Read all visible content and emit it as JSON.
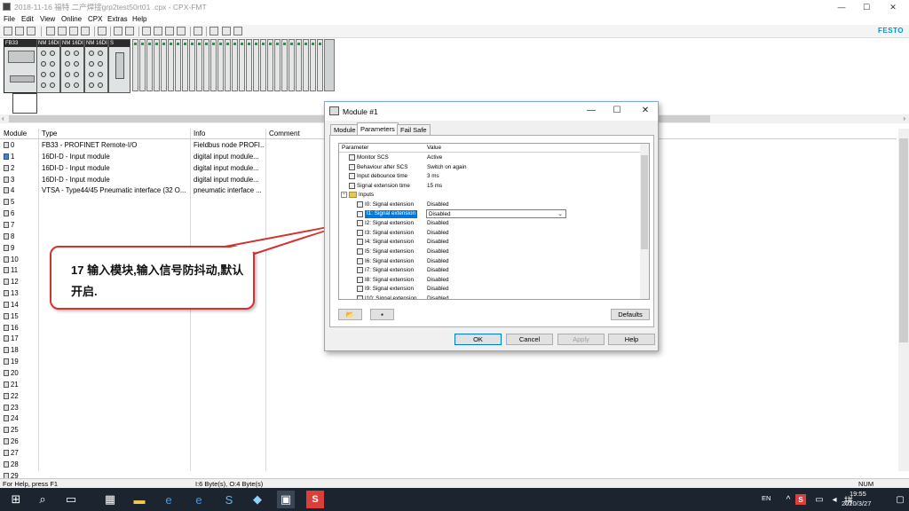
{
  "window": {
    "title": "2018-11-16 福特 二产焊接grp2test50rt01 .cpx - CPX-FMT",
    "controls": {
      "minimize": "—",
      "maximize": "☐",
      "close": "✕"
    }
  },
  "menu": [
    "File",
    "Edit",
    "View",
    "Online",
    "CPX",
    "Extras",
    "Help"
  ],
  "brand": {
    "logo": "FESTO",
    "color": "#0091dc"
  },
  "hardware": {
    "modules": [
      {
        "label": "FB33"
      },
      {
        "label": "NM 16DI-D"
      },
      {
        "label": "NM 16DI-D"
      },
      {
        "label": "NM 16DI-D"
      },
      {
        "label": "S"
      }
    ]
  },
  "grid": {
    "headers": {
      "module": "Module",
      "type": "Type",
      "info": "Info",
      "comment": "Comment"
    },
    "rows": [
      {
        "module": "0",
        "type": "FB33 - PROFINET Remote-I/O",
        "info": "Fieldbus node PROFI..."
      },
      {
        "module": "1",
        "type": "16DI-D - Input module",
        "info": "digital input module..."
      },
      {
        "module": "2",
        "type": "16DI-D - Input module",
        "info": "digital input module..."
      },
      {
        "module": "3",
        "type": "16DI-D - Input module",
        "info": "digital input module..."
      },
      {
        "module": "4",
        "type": "VTSA - Type44/45 Pneumatic interface (32 O...",
        "info": "pneumatic interface ..."
      },
      {
        "module": "5",
        "type": "",
        "info": ""
      },
      {
        "module": "6",
        "type": "",
        "info": ""
      },
      {
        "module": "7",
        "type": "",
        "info": ""
      },
      {
        "module": "8",
        "type": "",
        "info": ""
      },
      {
        "module": "9",
        "type": "",
        "info": ""
      },
      {
        "module": "10",
        "type": "",
        "info": ""
      },
      {
        "module": "11",
        "type": "",
        "info": ""
      },
      {
        "module": "12",
        "type": "",
        "info": ""
      },
      {
        "module": "13",
        "type": "",
        "info": ""
      },
      {
        "module": "14",
        "type": "",
        "info": ""
      },
      {
        "module": "15",
        "type": "",
        "info": ""
      },
      {
        "module": "16",
        "type": "",
        "info": ""
      },
      {
        "module": "17",
        "type": "",
        "info": ""
      },
      {
        "module": "18",
        "type": "",
        "info": ""
      },
      {
        "module": "19",
        "type": "",
        "info": ""
      },
      {
        "module": "20",
        "type": "",
        "info": ""
      },
      {
        "module": "21",
        "type": "",
        "info": ""
      },
      {
        "module": "22",
        "type": "",
        "info": ""
      },
      {
        "module": "23",
        "type": "",
        "info": ""
      },
      {
        "module": "24",
        "type": "",
        "info": ""
      },
      {
        "module": "25",
        "type": "",
        "info": ""
      },
      {
        "module": "26",
        "type": "",
        "info": ""
      },
      {
        "module": "27",
        "type": "",
        "info": ""
      },
      {
        "module": "28",
        "type": "",
        "info": ""
      },
      {
        "module": "29",
        "type": "",
        "info": ""
      }
    ],
    "selected_index": 1
  },
  "statusbar": {
    "help": "For Help, press F1",
    "io": "I:6 Byte(s), O:4 Byte(s)",
    "num": "NUM"
  },
  "callout": {
    "text": "17 输入模块,输入信号防抖动,默认开启.",
    "border_color": "#d3322f"
  },
  "dialog": {
    "title": "Module #1",
    "tabs": [
      "Module",
      "Parameters",
      "Fail Safe"
    ],
    "active_tab": 1,
    "param_headers": {
      "parameter": "Parameter",
      "value": "Value"
    },
    "params": [
      {
        "name": "Monitor SCS",
        "value": "Active"
      },
      {
        "name": "Behaviour after SCS",
        "value": "Switch on again"
      },
      {
        "name": "Input debounce time",
        "value": "3 ms"
      },
      {
        "name": "Signal extension time",
        "value": "15 ms"
      }
    ],
    "inputs_group": "Inputs",
    "inputs": [
      {
        "name": "I0: Signal extension",
        "value": "Disabled"
      },
      {
        "name": "I1: Signal extension",
        "value": "Disabled"
      },
      {
        "name": "I2: Signal extension",
        "value": "Disabled"
      },
      {
        "name": "I3: Signal extension",
        "value": "Disabled"
      },
      {
        "name": "I4: Signal extension",
        "value": "Disabled"
      },
      {
        "name": "I5: Signal extension",
        "value": "Disabled"
      },
      {
        "name": "I6: Signal extension",
        "value": "Disabled"
      },
      {
        "name": "I7: Signal extension",
        "value": "Disabled"
      },
      {
        "name": "I8: Signal extension",
        "value": "Disabled"
      },
      {
        "name": "I9: Signal extension",
        "value": "Disabled"
      },
      {
        "name": "I10: Signal extension",
        "value": "Disabled"
      }
    ],
    "selected_input": 1,
    "buttons": {
      "defaults": "Defaults",
      "ok": "OK",
      "cancel": "Cancel",
      "apply": "Apply",
      "help": "Help"
    }
  },
  "taskbar": {
    "lang": "EN",
    "time": "19:55",
    "date": "2020/3/27"
  }
}
